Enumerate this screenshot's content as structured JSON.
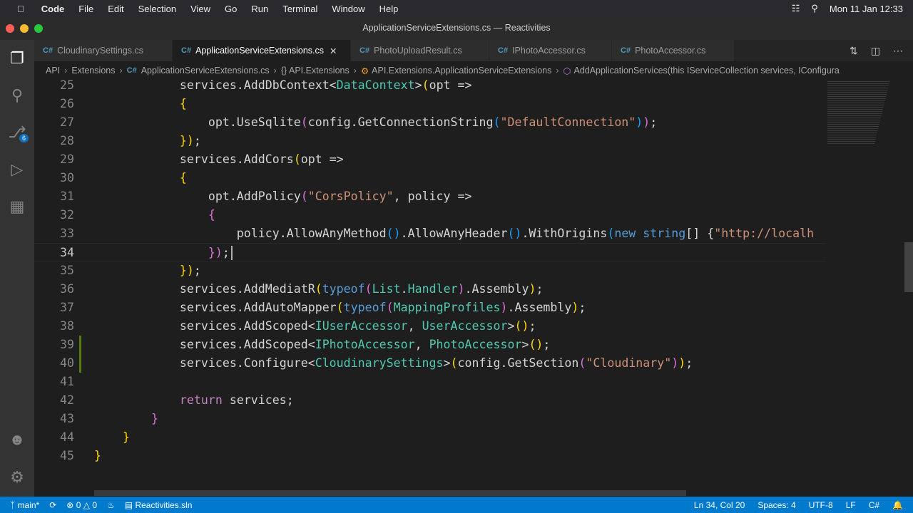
{
  "menubar": {
    "app": "Code",
    "items": [
      "File",
      "Edit",
      "Selection",
      "View",
      "Go",
      "Run",
      "Terminal",
      "Window",
      "Help"
    ],
    "clock": "Mon 11 Jan  12:33"
  },
  "window": {
    "title": "ApplicationServiceExtensions.cs — Reactivities"
  },
  "activity": {
    "source_control_badge": "6"
  },
  "tabs": [
    {
      "label": "CloudinarySettings.cs",
      "active": false
    },
    {
      "label": "ApplicationServiceExtensions.cs",
      "active": true
    },
    {
      "label": "PhotoUploadResult.cs",
      "active": false
    },
    {
      "label": "IPhotoAccessor.cs",
      "active": false
    },
    {
      "label": "PhotoAccessor.cs",
      "active": false
    }
  ],
  "tab_icon": "C#",
  "breadcrumbs": [
    "API",
    "Extensions",
    "ApplicationServiceExtensions.cs",
    "{} API.Extensions",
    "API.Extensions.ApplicationServiceExtensions",
    "AddApplicationServices(this IServiceCollection services, IConfigura"
  ],
  "editor": {
    "current_line": 34,
    "git_modified_lines": [
      39,
      40
    ],
    "lines": [
      {
        "n": 25,
        "tokens": [
          [
            "            services.AddDbContext<",
            "p"
          ],
          [
            "DataContext",
            "t"
          ],
          [
            ">",
            "p"
          ],
          [
            "(",
            "b1"
          ],
          [
            "opt => ",
            "p"
          ]
        ]
      },
      {
        "n": 26,
        "tokens": [
          [
            "            ",
            "p"
          ],
          [
            "{",
            "b1"
          ]
        ]
      },
      {
        "n": 27,
        "tokens": [
          [
            "                opt.UseSqlite",
            "p"
          ],
          [
            "(",
            "b2"
          ],
          [
            "config.GetConnectionString",
            "p"
          ],
          [
            "(",
            "b3"
          ],
          [
            "\"DefaultConnection\"",
            "s"
          ],
          [
            ")",
            "b3"
          ],
          [
            ")",
            "b2"
          ],
          [
            ";",
            "p"
          ]
        ]
      },
      {
        "n": 28,
        "tokens": [
          [
            "            ",
            "p"
          ],
          [
            "})",
            "b1"
          ],
          [
            ";",
            "p"
          ]
        ]
      },
      {
        "n": 29,
        "tokens": [
          [
            "            services.AddCors",
            "p"
          ],
          [
            "(",
            "b1"
          ],
          [
            "opt =>",
            "p"
          ]
        ]
      },
      {
        "n": 30,
        "tokens": [
          [
            "            ",
            "p"
          ],
          [
            "{",
            "b1"
          ]
        ]
      },
      {
        "n": 31,
        "tokens": [
          [
            "                opt.AddPolicy",
            "p"
          ],
          [
            "(",
            "b2"
          ],
          [
            "\"CorsPolicy\"",
            "s"
          ],
          [
            ", policy =>",
            "p"
          ]
        ]
      },
      {
        "n": 32,
        "tokens": [
          [
            "                ",
            "p"
          ],
          [
            "{",
            "b2"
          ]
        ]
      },
      {
        "n": 33,
        "tokens": [
          [
            "                    policy.AllowAnyMethod",
            "p"
          ],
          [
            "()",
            "b3"
          ],
          [
            ".AllowAnyHeader",
            "p"
          ],
          [
            "()",
            "b3"
          ],
          [
            ".WithOrigins",
            "p"
          ],
          [
            "(",
            "b3"
          ],
          [
            "new string",
            "k"
          ],
          [
            "[] {",
            "p"
          ],
          [
            "\"http://localh",
            "s"
          ]
        ]
      },
      {
        "n": 34,
        "tokens": [
          [
            "                ",
            "p"
          ],
          [
            "})",
            "b2"
          ],
          [
            ";",
            "p"
          ]
        ]
      },
      {
        "n": 35,
        "tokens": [
          [
            "            ",
            "p"
          ],
          [
            "})",
            "b1"
          ],
          [
            ";",
            "p"
          ]
        ]
      },
      {
        "n": 36,
        "tokens": [
          [
            "            services.AddMediatR",
            "p"
          ],
          [
            "(",
            "b1"
          ],
          [
            "typeof",
            "k"
          ],
          [
            "(",
            "b2"
          ],
          [
            "List",
            "t"
          ],
          [
            ".",
            "p"
          ],
          [
            "Handler",
            "t"
          ],
          [
            ")",
            "b2"
          ],
          [
            ".Assembly",
            "p"
          ],
          [
            ")",
            "b1"
          ],
          [
            ";",
            "p"
          ]
        ]
      },
      {
        "n": 37,
        "tokens": [
          [
            "            services.AddAutoMapper",
            "p"
          ],
          [
            "(",
            "b1"
          ],
          [
            "typeof",
            "k"
          ],
          [
            "(",
            "b2"
          ],
          [
            "MappingProfiles",
            "t"
          ],
          [
            ")",
            "b2"
          ],
          [
            ".Assembly",
            "p"
          ],
          [
            ")",
            "b1"
          ],
          [
            ";",
            "p"
          ]
        ]
      },
      {
        "n": 38,
        "tokens": [
          [
            "            services.AddScoped<",
            "p"
          ],
          [
            "IUserAccessor",
            "t"
          ],
          [
            ", ",
            "p"
          ],
          [
            "UserAccessor",
            "t"
          ],
          [
            ">",
            "p"
          ],
          [
            "()",
            "b1"
          ],
          [
            ";",
            "p"
          ]
        ]
      },
      {
        "n": 39,
        "tokens": [
          [
            "            services.AddScoped<",
            "p"
          ],
          [
            "IPhotoAccessor",
            "t"
          ],
          [
            ", ",
            "p"
          ],
          [
            "PhotoAccessor",
            "t"
          ],
          [
            ">",
            "p"
          ],
          [
            "()",
            "b1"
          ],
          [
            ";",
            "p"
          ]
        ]
      },
      {
        "n": 40,
        "tokens": [
          [
            "            services.Configure<",
            "p"
          ],
          [
            "CloudinarySettings",
            "t"
          ],
          [
            ">",
            "p"
          ],
          [
            "(",
            "b1"
          ],
          [
            "config.GetSection",
            "p"
          ],
          [
            "(",
            "b2"
          ],
          [
            "\"Cloudinary\"",
            "s"
          ],
          [
            ")",
            "b2"
          ],
          [
            ")",
            "b1"
          ],
          [
            ";",
            "p"
          ]
        ]
      },
      {
        "n": 41,
        "tokens": []
      },
      {
        "n": 42,
        "tokens": [
          [
            "            ",
            "p"
          ],
          [
            "return",
            "c"
          ],
          [
            " services;",
            "p"
          ]
        ]
      },
      {
        "n": 43,
        "tokens": [
          [
            "        ",
            "p"
          ],
          [
            "}",
            "b2"
          ]
        ]
      },
      {
        "n": 44,
        "tokens": [
          [
            "    ",
            "p"
          ],
          [
            "}",
            "b1"
          ]
        ]
      },
      {
        "n": 45,
        "tokens": [
          [
            "}",
            "b1"
          ]
        ]
      }
    ]
  },
  "status": {
    "branch": "main*",
    "errors": "0",
    "warnings": "0",
    "solution": "Reactivities.sln",
    "position": "Ln 34, Col 20",
    "spaces": "Spaces: 4",
    "encoding": "UTF-8",
    "eol": "LF",
    "language": "C#"
  },
  "colors": {
    "status_bar": "#007acc",
    "editor_bg": "#1e1e1e",
    "type": "#4ec9b0",
    "string": "#ce9178",
    "keyword": "#569cd6"
  }
}
